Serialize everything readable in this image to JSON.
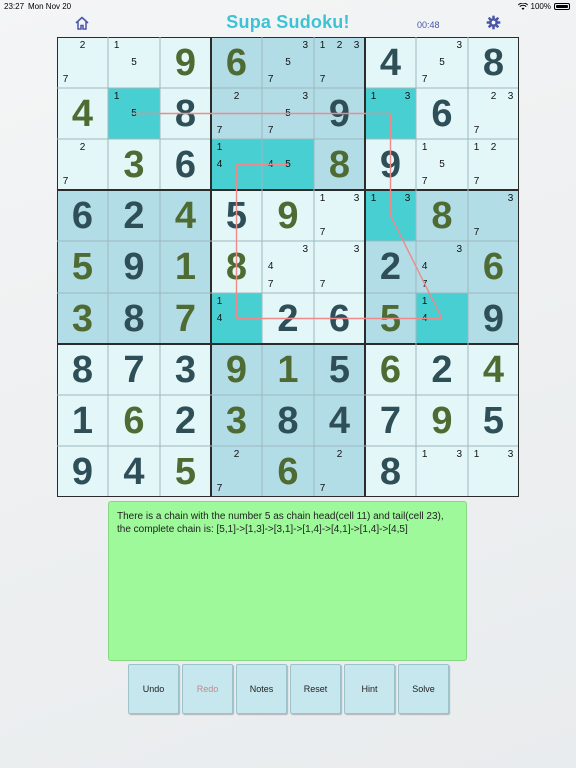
{
  "status": {
    "time": "23:27",
    "date": "Mon Nov 20",
    "battery": "100%"
  },
  "header": {
    "title": "Supa Sudoku!",
    "timer": "00:48",
    "home_icon": "home-icon",
    "settings_icon": "gear-icon"
  },
  "colors": {
    "light_cell": "#e4f7f8",
    "dark_cell": "#b3dde6",
    "highlight_cell": "#47cfd2",
    "given_digit": "#2e4e58",
    "entered_digit": "#4e6b33",
    "chain_line": "#f08a8a",
    "hint_bg": "#9ef99a"
  },
  "board": {
    "rows": [
      [
        {
          "n": [
            2,
            7
          ]
        },
        {
          "n": [
            1,
            5
          ]
        },
        {
          "v": "9",
          "t": "e"
        },
        {
          "v": "6",
          "t": "e"
        },
        {
          "n": [
            3,
            5,
            7
          ]
        },
        {
          "n": [
            1,
            2,
            3,
            7
          ]
        },
        {
          "v": "4",
          "t": "g"
        },
        {
          "n": [
            3,
            5,
            7
          ]
        },
        {
          "v": "8",
          "t": "g"
        }
      ],
      [
        {
          "v": "4",
          "t": "e"
        },
        {
          "n": [
            1,
            5
          ]
        },
        {
          "v": "8",
          "t": "g"
        },
        {
          "n": [
            2,
            7
          ]
        },
        {
          "n": [
            3,
            5,
            7
          ]
        },
        {
          "v": "9",
          "t": "g"
        },
        {
          "n": [
            1,
            3
          ]
        },
        {
          "v": "6",
          "t": "g"
        },
        {
          "n": [
            2,
            3,
            7
          ]
        }
      ],
      [
        {
          "n": [
            2,
            7
          ]
        },
        {
          "v": "3",
          "t": "e"
        },
        {
          "v": "6",
          "t": "g"
        },
        {
          "n": [
            1,
            4
          ]
        },
        {
          "n": [
            4,
            5
          ]
        },
        {
          "v": "8",
          "t": "e"
        },
        {
          "v": "9",
          "t": "g"
        },
        {
          "n": [
            1,
            5,
            7
          ]
        },
        {
          "n": [
            1,
            2,
            7
          ]
        }
      ],
      [
        {
          "v": "6",
          "t": "g"
        },
        {
          "v": "2",
          "t": "g"
        },
        {
          "v": "4",
          "t": "e"
        },
        {
          "v": "5",
          "t": "g"
        },
        {
          "v": "9",
          "t": "e"
        },
        {
          "n": [
            1,
            3,
            7
          ]
        },
        {
          "n": [
            1,
            3
          ]
        },
        {
          "v": "8",
          "t": "e"
        },
        {
          "n": [
            3,
            7
          ]
        }
      ],
      [
        {
          "v": "5",
          "t": "e"
        },
        {
          "v": "9",
          "t": "g"
        },
        {
          "v": "1",
          "t": "e"
        },
        {
          "v": "8",
          "t": "e"
        },
        {
          "n": [
            3,
            4,
            7
          ]
        },
        {
          "n": [
            3,
            7
          ]
        },
        {
          "v": "2",
          "t": "g"
        },
        {
          "n": [
            3,
            4,
            7
          ]
        },
        {
          "v": "6",
          "t": "e"
        }
      ],
      [
        {
          "v": "3",
          "t": "e"
        },
        {
          "v": "8",
          "t": "g"
        },
        {
          "v": "7",
          "t": "e"
        },
        {
          "n": [
            1,
            4
          ]
        },
        {
          "v": "2",
          "t": "g"
        },
        {
          "v": "6",
          "t": "g"
        },
        {
          "v": "5",
          "t": "e"
        },
        {
          "n": [
            1,
            4
          ]
        },
        {
          "v": "9",
          "t": "g"
        }
      ],
      [
        {
          "v": "8",
          "t": "g"
        },
        {
          "v": "7",
          "t": "g"
        },
        {
          "v": "3",
          "t": "g"
        },
        {
          "v": "9",
          "t": "e"
        },
        {
          "v": "1",
          "t": "e"
        },
        {
          "v": "5",
          "t": "g"
        },
        {
          "v": "6",
          "t": "e"
        },
        {
          "v": "2",
          "t": "g"
        },
        {
          "v": "4",
          "t": "e"
        }
      ],
      [
        {
          "v": "1",
          "t": "g"
        },
        {
          "v": "6",
          "t": "e"
        },
        {
          "v": "2",
          "t": "g"
        },
        {
          "v": "3",
          "t": "e"
        },
        {
          "v": "8",
          "t": "g"
        },
        {
          "v": "4",
          "t": "g"
        },
        {
          "v": "7",
          "t": "g"
        },
        {
          "v": "9",
          "t": "e"
        },
        {
          "v": "5",
          "t": "g"
        }
      ],
      [
        {
          "v": "9",
          "t": "g"
        },
        {
          "v": "4",
          "t": "g"
        },
        {
          "v": "5",
          "t": "e"
        },
        {
          "n": [
            2,
            7
          ]
        },
        {
          "v": "6",
          "t": "e"
        },
        {
          "n": [
            2,
            7
          ]
        },
        {
          "v": "8",
          "t": "g"
        },
        {
          "n": [
            1,
            3
          ]
        },
        {
          "n": [
            1,
            3
          ]
        }
      ]
    ],
    "highlighted": [
      [
        1,
        1
      ],
      [
        1,
        6
      ],
      [
        2,
        3
      ],
      [
        2,
        4
      ],
      [
        3,
        6
      ],
      [
        5,
        3
      ],
      [
        5,
        7
      ]
    ],
    "chain_path": [
      [
        1,
        1
      ],
      [
        1,
        6
      ],
      [
        3,
        6
      ],
      [
        5,
        7
      ],
      [
        5,
        3
      ],
      [
        2,
        3
      ],
      [
        2,
        4
      ]
    ]
  },
  "hint": {
    "message": "There is a chain with the number 5 as chain head(cell 11) and tail(cell 23), the complete chain is: [5,1]->[1,3]->[3,1]->[1,4]->[4,1]->[1,4]->[4,5]"
  },
  "buttons": {
    "undo": "Undo",
    "redo": "Redo",
    "notes": "Notes",
    "reset": "Reset",
    "hint": "Hint",
    "solve": "Solve"
  }
}
